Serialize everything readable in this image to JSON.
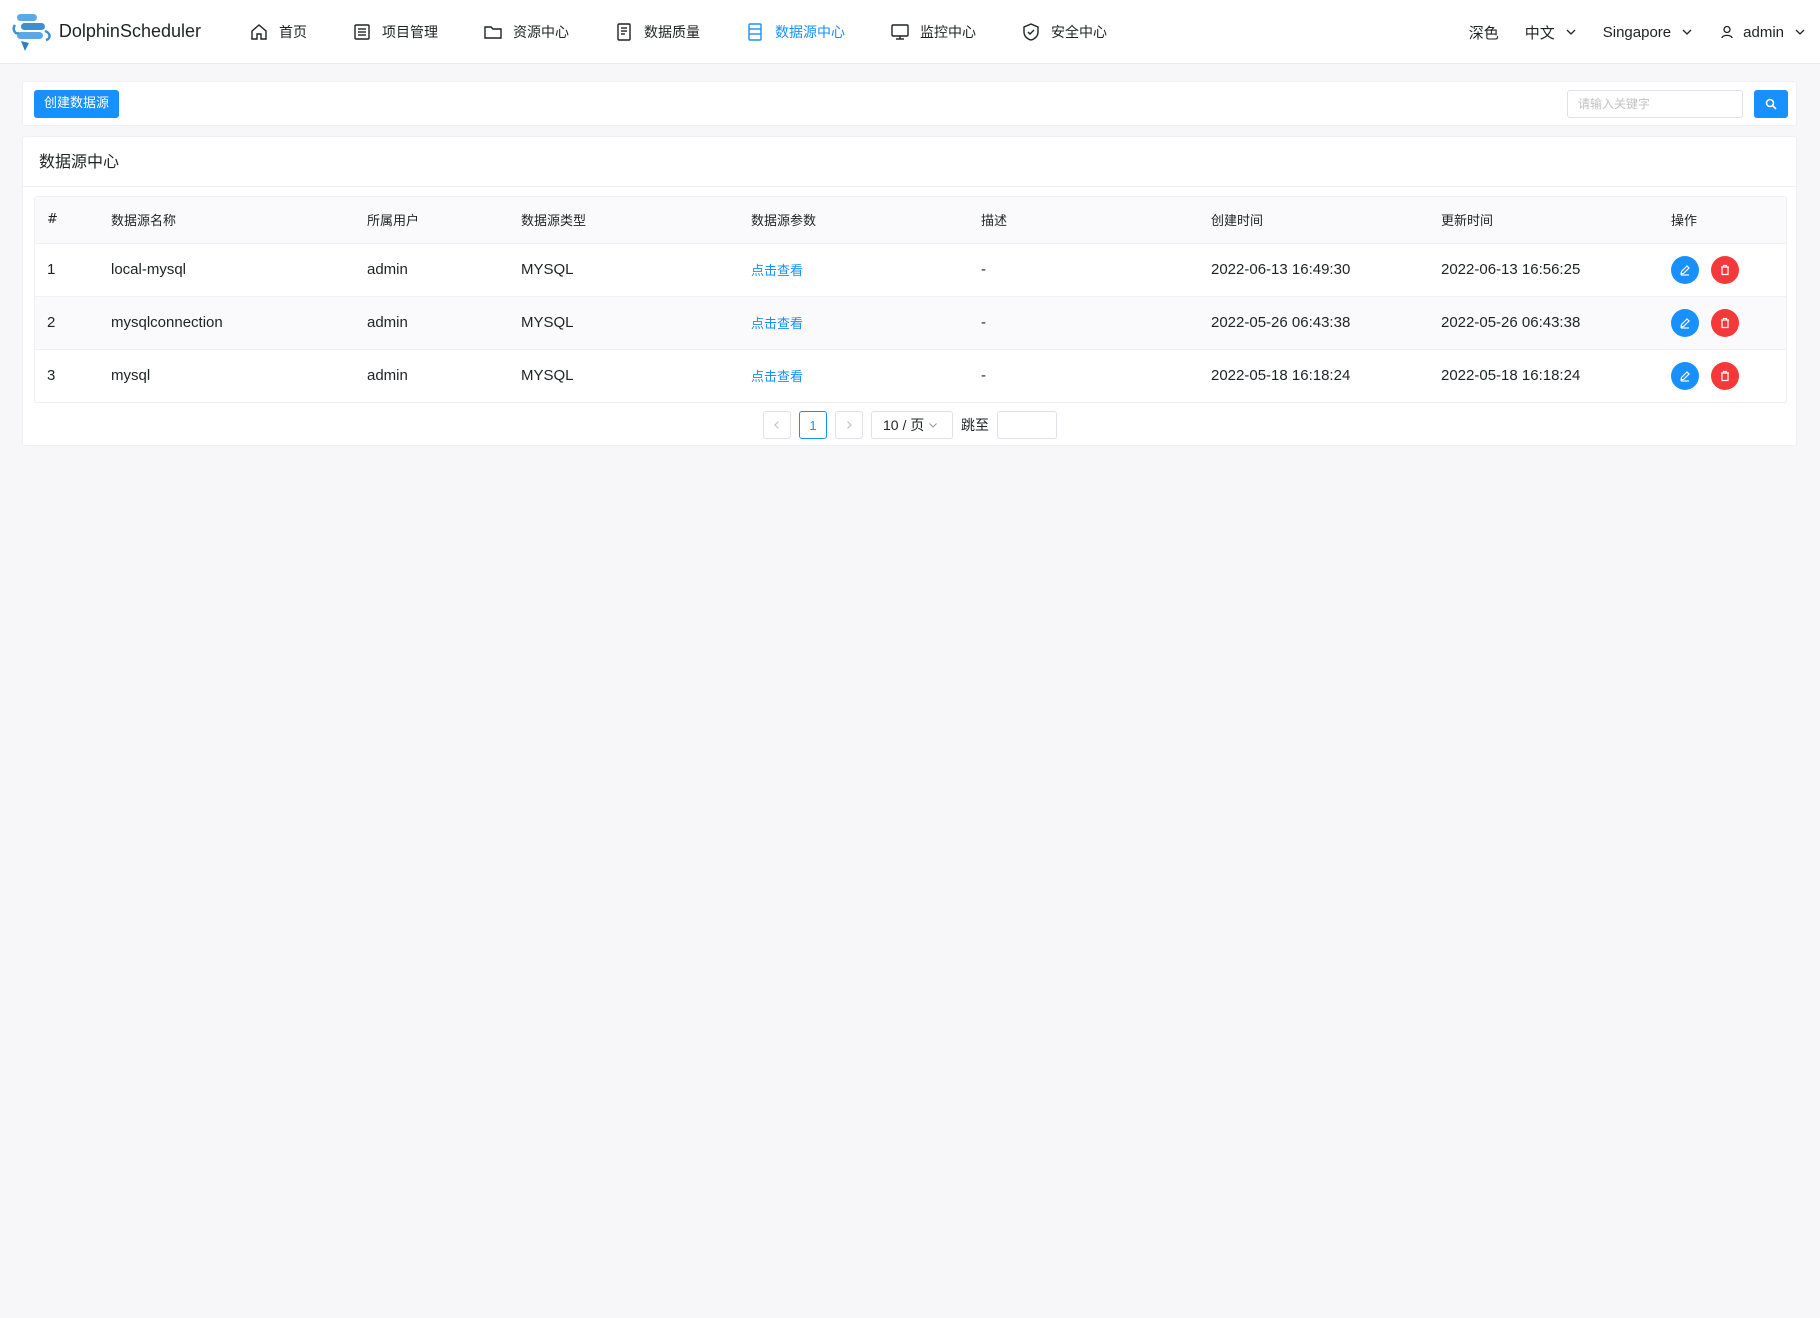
{
  "app": {
    "logo_text": "DolphinScheduler",
    "accent_color": "#1890ff",
    "danger_color": "#f5393b"
  },
  "nav": {
    "items": [
      {
        "label": "首页",
        "icon": "home-icon"
      },
      {
        "label": "项目管理",
        "icon": "project-icon"
      },
      {
        "label": "资源中心",
        "icon": "folder-icon"
      },
      {
        "label": "数据质量",
        "icon": "document-icon"
      },
      {
        "label": "数据源中心",
        "icon": "datasource-icon",
        "active": true
      },
      {
        "label": "监控中心",
        "icon": "monitor-icon"
      },
      {
        "label": "安全中心",
        "icon": "shield-icon"
      }
    ]
  },
  "header_right": {
    "theme": "深色",
    "language": "中文",
    "timezone": "Singapore",
    "user": "admin"
  },
  "toolbar": {
    "create_label": "创建数据源",
    "search_placeholder": "请输入关键字"
  },
  "card": {
    "title": "数据源中心"
  },
  "table": {
    "headers": [
      "#",
      "数据源名称",
      "所属用户",
      "数据源类型",
      "数据源参数",
      "描述",
      "创建时间",
      "更新时间",
      "操作"
    ],
    "rows": [
      {
        "index": "1",
        "name": "local-mysql",
        "user": "admin",
        "type": "MYSQL",
        "params": "点击查看",
        "desc": "-",
        "created": "2022-06-13 16:49:30",
        "updated": "2022-06-13 16:56:25"
      },
      {
        "index": "2",
        "name": "mysqlconnection",
        "user": "admin",
        "type": "MYSQL",
        "params": "点击查看",
        "desc": "-",
        "created": "2022-05-26 06:43:38",
        "updated": "2022-05-26 06:43:38"
      },
      {
        "index": "3",
        "name": "mysql",
        "user": "admin",
        "type": "MYSQL",
        "params": "点击查看",
        "desc": "-",
        "created": "2022-05-18 16:18:24",
        "updated": "2022-05-18 16:18:24"
      }
    ]
  },
  "pagination": {
    "current_page": "1",
    "page_size": "10 / 页",
    "jump_label": "跳至"
  }
}
